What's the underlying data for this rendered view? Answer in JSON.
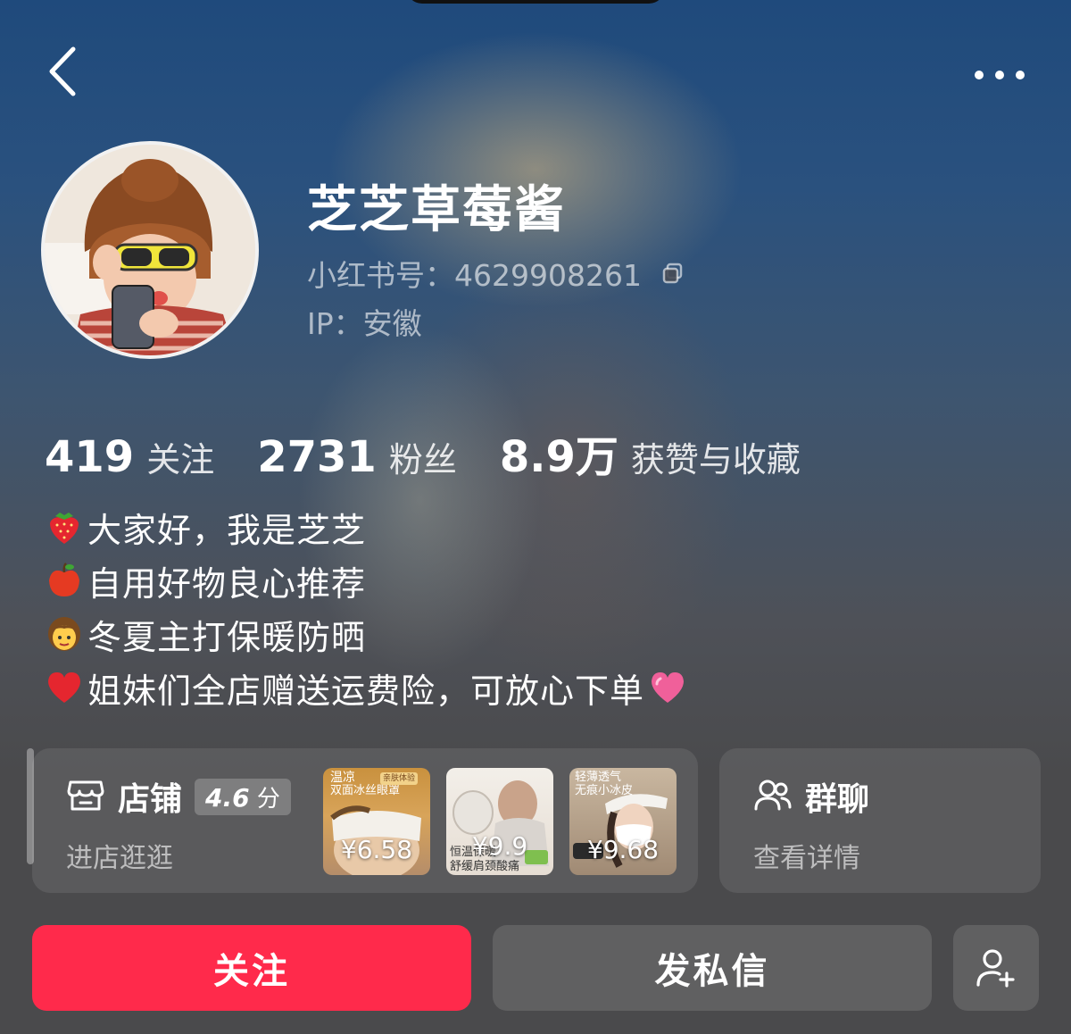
{
  "profile": {
    "nickname": "芝芝草莓酱",
    "red_id": "小红书号：4629908261",
    "ip": "IP：安徽"
  },
  "stats": [
    {
      "value": "419",
      "label": "关注"
    },
    {
      "value": "2731",
      "label": "粉丝"
    },
    {
      "value": "8.9万",
      "label": "获赞与收藏"
    }
  ],
  "bio": [
    {
      "icon": "strawberry-emoji",
      "text": "大家好，我是芝芝"
    },
    {
      "icon": "apple-emoji",
      "text": "自用好物良心推荐"
    },
    {
      "icon": "girl-emoji",
      "text": "冬夏主打保暖防晒"
    },
    {
      "icon": "heart-emoji",
      "text": "姐妹们全店赠送运费险，可放心下单",
      "tail_icon": "pink-heart-emoji"
    }
  ],
  "shop": {
    "label": "店铺",
    "rating_value": "4.6",
    "rating_unit": "分",
    "subtitle": "进店逛逛",
    "products": [
      {
        "price": "¥6.58",
        "caption1": "温凉",
        "caption2": "双面冰丝眼罩",
        "badge": "亲肤体验"
      },
      {
        "price": "¥9.9",
        "caption1": "恒温保暖",
        "caption2": "舒缓肩颈酸痛"
      },
      {
        "price": "¥9.68",
        "caption1": "轻薄透气",
        "caption2": "无痕小冰皮"
      }
    ]
  },
  "group": {
    "label": "群聊",
    "subtitle": "查看详情"
  },
  "actions": {
    "follow": "关注",
    "message": "发私信"
  },
  "colors": {
    "accent": "#ff2a4b",
    "bg_top": "#1f4a7c",
    "bg_bottom": "#4a4a4c"
  }
}
